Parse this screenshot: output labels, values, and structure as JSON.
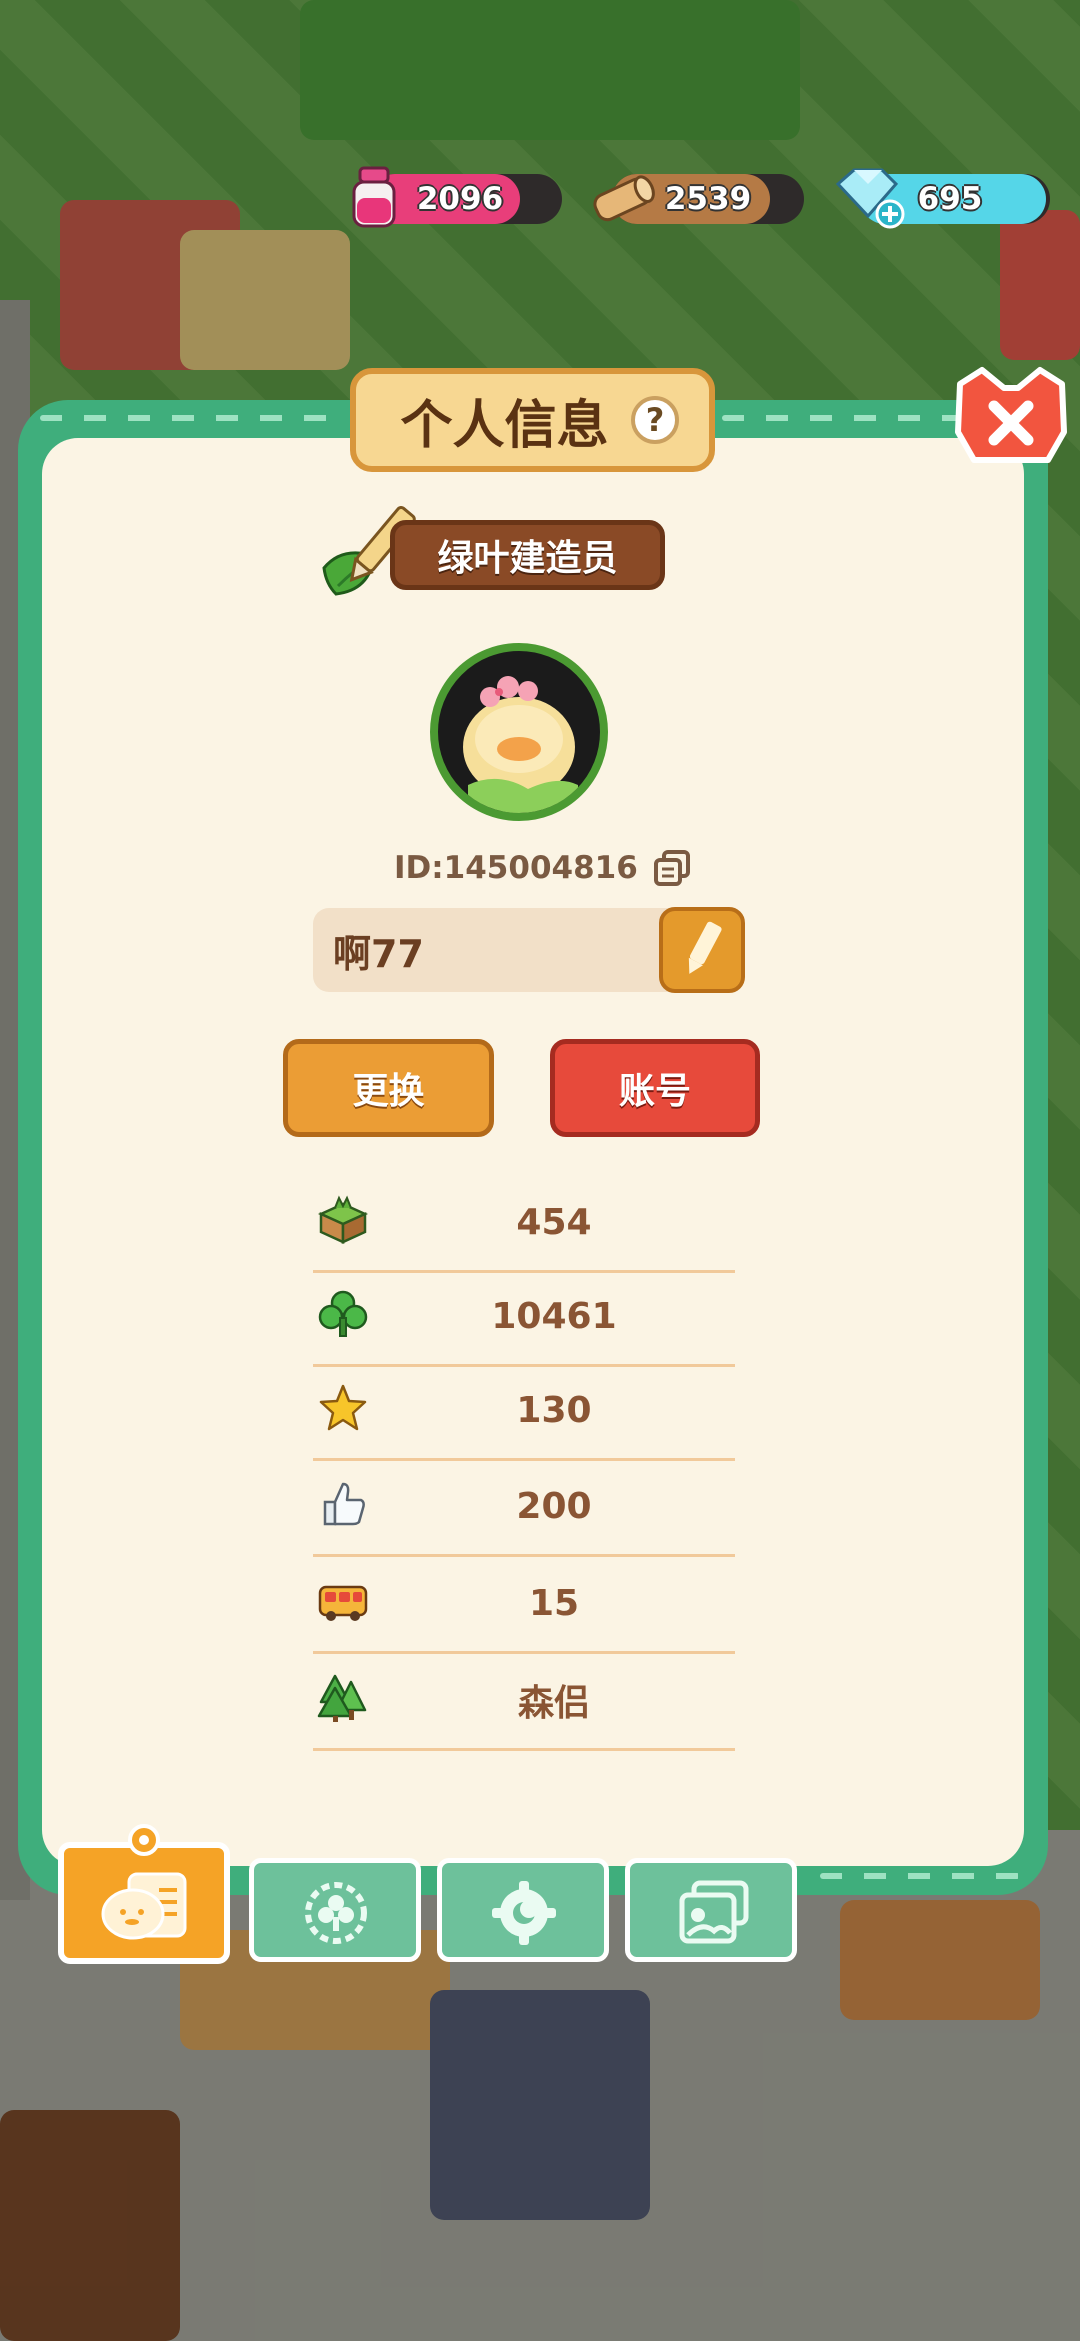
{
  "resources": [
    {
      "name": "ink",
      "icon": "ink-bottle-icon",
      "value": "2096",
      "color": "#e83e7a"
    },
    {
      "name": "wood",
      "icon": "wood-log-icon",
      "value": "2539",
      "color": "#b57a45"
    },
    {
      "name": "diamond",
      "icon": "diamond-plus-icon",
      "value": "695",
      "color": "#55d6e8"
    }
  ],
  "panel": {
    "title": "个人信息",
    "help": "?",
    "rank": "绿叶建造员",
    "player_id": "ID:145004816",
    "name": "啊77",
    "change_label": "更换",
    "account_label": "账号"
  },
  "stats": [
    {
      "icon": "land-block-icon",
      "value": "454"
    },
    {
      "icon": "clover-icon",
      "value": "10461"
    },
    {
      "icon": "star-icon",
      "value": "130"
    },
    {
      "icon": "thumbs-up-icon",
      "value": "200"
    },
    {
      "icon": "bus-icon",
      "value": "15"
    },
    {
      "icon": "tree-icon",
      "value": "森侣"
    }
  ],
  "tabs": [
    {
      "name": "profile-card",
      "icon": "profile-card-icon",
      "active": true
    },
    {
      "name": "badge",
      "icon": "badge-flower-icon",
      "active": false
    },
    {
      "name": "gear",
      "icon": "gear-moon-icon",
      "active": false
    },
    {
      "name": "album",
      "icon": "photo-album-icon",
      "active": false
    }
  ],
  "colors": {
    "panel_border": "#3fae7c",
    "panel_bg": "#fbf4e4",
    "title_bg": "#f7d792",
    "change_button": "#eb9d35",
    "account_button": "#e74a3b",
    "tab_active": "#f5a326",
    "tab_normal": "#6dc19b",
    "close_button": "#f2553f"
  }
}
